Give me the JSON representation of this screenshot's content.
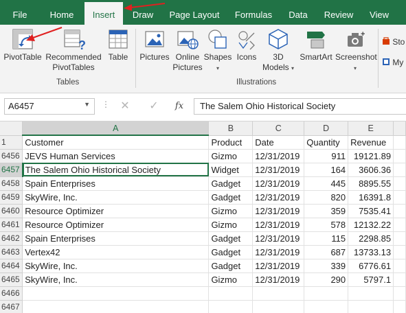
{
  "tabs": {
    "file": "File",
    "home": "Home",
    "insert": "Insert",
    "draw": "Draw",
    "page_layout": "Page Layout",
    "formulas": "Formulas",
    "data": "Data",
    "review": "Review",
    "view": "View",
    "active": "Insert"
  },
  "ribbon": {
    "tables": {
      "label": "Tables",
      "pivottable": "PivotTable",
      "recommended_line1": "Recommended",
      "recommended_line2": "PivotTables",
      "table": "Table"
    },
    "illustrations": {
      "label": "Illustrations",
      "pictures": "Pictures",
      "online_line1": "Online",
      "online_line2": "Pictures",
      "shapes": "Shapes",
      "icons": "Icons",
      "models_line1": "3D",
      "models_line2": "Models",
      "smartart": "SmartArt",
      "screenshot": "Screenshot"
    },
    "addins": {
      "store": "Sto",
      "myaddins": "My"
    }
  },
  "formula_bar": {
    "name_box": "A6457",
    "content": "The Salem Ohio Historical Society",
    "fx": "fx"
  },
  "colors": {
    "excel_green": "#217346",
    "annotation_red": "#e02020"
  },
  "sheet": {
    "columns": [
      "A",
      "B",
      "C",
      "D",
      "E"
    ],
    "active_column": "A",
    "active_row": "6457",
    "rows": [
      {
        "row": "1",
        "cells": [
          "Customer",
          "Product",
          "Date",
          "Quantity",
          "Revenue"
        ]
      },
      {
        "row": "6456",
        "cells": [
          "JEVS Human Services",
          "Gizmo",
          "12/31/2019",
          "911",
          "19121.89"
        ]
      },
      {
        "row": "6457",
        "cells": [
          "The Salem Ohio Historical Society",
          "Widget",
          "12/31/2019",
          "164",
          "3606.36"
        ]
      },
      {
        "row": "6458",
        "cells": [
          "Spain Enterprises",
          "Gadget",
          "12/31/2019",
          "445",
          "8895.55"
        ]
      },
      {
        "row": "6459",
        "cells": [
          "SkyWire, Inc.",
          "Gadget",
          "12/31/2019",
          "820",
          "16391.8"
        ]
      },
      {
        "row": "6460",
        "cells": [
          "Resource Optimizer",
          "Gizmo",
          "12/31/2019",
          "359",
          "7535.41"
        ]
      },
      {
        "row": "6461",
        "cells": [
          "Resource Optimizer",
          "Gizmo",
          "12/31/2019",
          "578",
          "12132.22"
        ]
      },
      {
        "row": "6462",
        "cells": [
          "Spain Enterprises",
          "Gadget",
          "12/31/2019",
          "115",
          "2298.85"
        ]
      },
      {
        "row": "6463",
        "cells": [
          "Vertex42",
          "Gadget",
          "12/31/2019",
          "687",
          "13733.13"
        ]
      },
      {
        "row": "6464",
        "cells": [
          "SkyWire, Inc.",
          "Gadget",
          "12/31/2019",
          "339",
          "6776.61"
        ]
      },
      {
        "row": "6465",
        "cells": [
          "SkyWire, Inc.",
          "Gizmo",
          "12/31/2019",
          "290",
          "5797.1"
        ]
      },
      {
        "row": "6466",
        "cells": [
          "",
          "",
          "",
          "",
          ""
        ]
      },
      {
        "row": "6467",
        "cells": [
          "",
          "",
          "",
          "",
          ""
        ]
      }
    ]
  }
}
